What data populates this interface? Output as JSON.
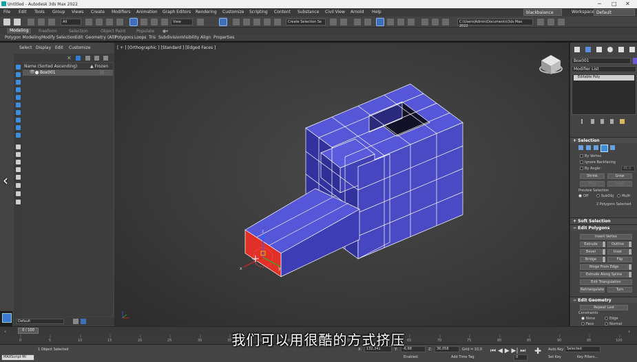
{
  "window": {
    "title": "Untitled - Autodesk 3ds Max 2022",
    "workspace_label": "Workspaces:",
    "workspace_value": "Default",
    "user": "blackbalance"
  },
  "menu": [
    "File",
    "Edit",
    "Tools",
    "Group",
    "Views",
    "Create",
    "Modifiers",
    "Animation",
    "Graph Editors",
    "Rendering",
    "Customize",
    "Scripting",
    "Content",
    "Substance",
    "Civil View",
    "Arnold",
    "Help"
  ],
  "toolbar": {
    "filter": "All",
    "view": "View",
    "selection_set": "Create Selection Se",
    "path": "C:\\Users\\Admin\\Documents\\3ds Max 2022"
  },
  "ribbon": {
    "tabs": [
      "Modeling",
      "Freeform",
      "Selection",
      "Object Paint",
      "Populate"
    ],
    "active_tab": "Modeling",
    "panels": [
      "Polygon Modeling",
      "Modify Selection",
      "Edit",
      "Geometry (All)",
      "Polygons",
      "Loops",
      "Tris",
      "Subdivision",
      "Visibility",
      "Align",
      "Properties"
    ]
  },
  "explorer": {
    "tabs": [
      "Select",
      "Display",
      "Edit",
      "Customize"
    ],
    "col_name": "Name (Sorted Ascending)",
    "col_frozen": "▲ Frozen",
    "object": "Box001",
    "layer": "Default"
  },
  "viewport": {
    "label": "[ + ] [Orthographic ] [Standard ] [Edged Faces ]"
  },
  "command_panel": {
    "object_name": "Box001",
    "modifier_list": "Modifier List",
    "stack_item": "Editable Poly",
    "selection": {
      "title": "Selection",
      "by_vertex": "By Vertex",
      "ignore_backfacing": "Ignore Backfacing",
      "by_angle": "By Angle:",
      "by_angle_value": "45,0",
      "shrink": "Shrink",
      "grow": "Grow",
      "ring": "Ring",
      "loop": "Loop",
      "preview_selection": "Preview Selection",
      "preview_off": "Off",
      "preview_subobj": "SubObj",
      "preview_multi": "Multi",
      "selected_count": "2 Polygons Selected"
    },
    "soft_selection": "Soft Selection",
    "edit_polygons": {
      "title": "Edit Polygons",
      "insert_vertex": "Insert Vertex",
      "extrude": "Extrude",
      "outline": "Outline",
      "bevel": "Bevel",
      "inset": "Inset",
      "bridge": "Bridge",
      "flip": "Flip",
      "hinge": "Hinge From Edge",
      "extrude_spline": "Extrude Along Spline",
      "edit_triangulation": "Edit Triangulation",
      "retriangulate": "Retriangulate",
      "turn": "Turn"
    },
    "edit_geometry": {
      "title": "Edit Geometry",
      "repeat_last": "Repeat Last",
      "constraints": "Constraints",
      "none": "None",
      "edge": "Edge",
      "face": "Face",
      "normal": "Normal"
    }
  },
  "timeline": {
    "slider": "0 / 100",
    "ticks": [
      "0",
      "5",
      "10",
      "15",
      "20",
      "25",
      "30",
      "35",
      "40",
      "45",
      "50",
      "55",
      "60",
      "65",
      "70",
      "75",
      "80",
      "85",
      "90",
      "95",
      "100"
    ]
  },
  "status": {
    "maxscript": "MAXScript Mi",
    "objects_selected": "1 Object Selected",
    "x_label": "X:",
    "x_value": "132,341",
    "y_label": "Y:",
    "y_value": "-6,68",
    "z_label": "Z:",
    "z_value": "36,058",
    "grid": "Grid = 10,0",
    "add_time_tag": "Add Time Tag",
    "enabled": "Enabled:",
    "auto_key": "Auto Key",
    "set_key": "Set Key",
    "selected": "Selected",
    "key_filters": "Key Filters...",
    "frame": "0"
  },
  "subtitle": "我们可以用很酷的方式挤压",
  "colors": {
    "mesh": "#5252d6",
    "mesh_dark": "#2a2a8a",
    "selected_face": "#e0302a",
    "accent": "#5a8fd6"
  }
}
